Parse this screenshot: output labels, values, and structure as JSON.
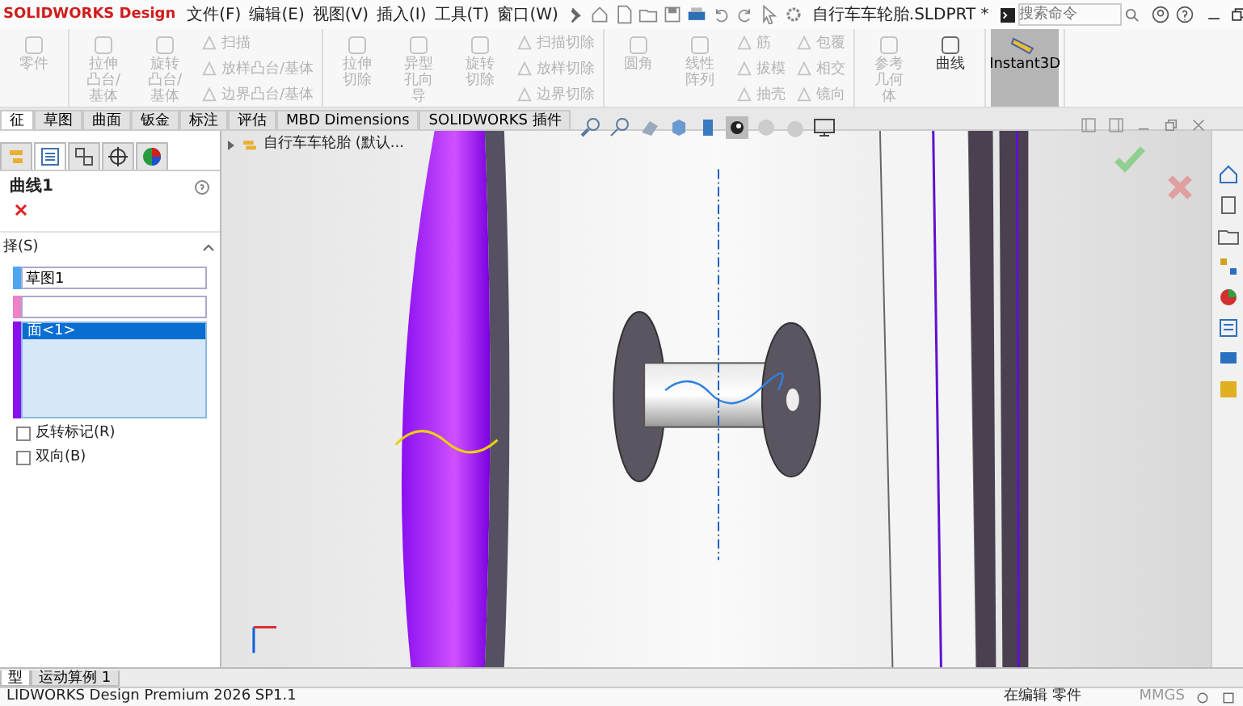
{
  "window": {
    "logo": "SOLIDWORKS Design",
    "document_title": "自行车车轮胎.SLDPRT *",
    "search": {
      "placeholder": "搜索命令"
    }
  },
  "menu": [
    "文件(F)",
    "编辑(E)",
    "视图(V)",
    "插入(I)",
    "工具(T)",
    "窗口(W)"
  ],
  "ribbon": [
    {
      "items": [
        {
          "kind": "large",
          "label": "零件",
          "disabled": true
        }
      ]
    },
    {
      "items": [
        {
          "kind": "large",
          "label": "拉伸凸台/基体",
          "disabled": true
        },
        {
          "kind": "large",
          "label": "旋转凸台/基体",
          "disabled": true
        },
        {
          "kind": "small",
          "label": "扫描",
          "disabled": true
        },
        {
          "kind": "small",
          "label": "放样凸台/基体",
          "disabled": true
        },
        {
          "kind": "small",
          "label": "边界凸台/基体",
          "disabled": true
        }
      ]
    },
    {
      "items": [
        {
          "kind": "large",
          "label": "拉伸切除",
          "disabled": true
        },
        {
          "kind": "large",
          "label": "异型孔向导",
          "disabled": true
        },
        {
          "kind": "large",
          "label": "旋转切除",
          "disabled": true
        },
        {
          "kind": "small",
          "label": "扫描切除",
          "disabled": true
        },
        {
          "kind": "small",
          "label": "放样切除",
          "disabled": true
        },
        {
          "kind": "small",
          "label": "边界切除",
          "disabled": true
        }
      ]
    },
    {
      "items": [
        {
          "kind": "large",
          "label": "圆角",
          "disabled": true
        },
        {
          "kind": "large",
          "label": "线性阵列",
          "disabled": true
        },
        {
          "kind": "small",
          "label": "筋",
          "disabled": true
        },
        {
          "kind": "small",
          "label": "拔模",
          "disabled": true
        },
        {
          "kind": "small",
          "label": "抽壳",
          "disabled": true
        },
        {
          "kind": "small",
          "label": "包覆",
          "disabled": true
        },
        {
          "kind": "small",
          "label": "相交",
          "disabled": true
        },
        {
          "kind": "small",
          "label": "镜向",
          "disabled": true
        }
      ]
    },
    {
      "items": [
        {
          "kind": "large",
          "label": "参考几何体",
          "disabled": true
        },
        {
          "kind": "large",
          "label": "曲线",
          "disabled": false
        }
      ]
    },
    {
      "items": [
        {
          "kind": "toggle",
          "label": "Instant3D",
          "selected": true
        }
      ]
    }
  ],
  "command_tabs": [
    {
      "label": "征",
      "selected": true
    },
    {
      "label": "草图",
      "selected": false
    },
    {
      "label": "曲面",
      "selected": false
    },
    {
      "label": "钣金",
      "selected": false
    },
    {
      "label": "标注",
      "selected": false
    },
    {
      "label": "评估",
      "selected": false
    },
    {
      "label": "MBD Dimensions",
      "selected": false
    },
    {
      "label": "SOLIDWORKS 插件",
      "selected": false
    }
  ],
  "property_manager": {
    "tabs": [
      {
        "kind": "feature",
        "selected": false
      },
      {
        "kind": "property",
        "selected": true
      },
      {
        "kind": "config",
        "selected": false
      },
      {
        "kind": "origin",
        "selected": false
      },
      {
        "kind": "appearance",
        "selected": false
      }
    ],
    "title": "曲线1",
    "section": "择(S)",
    "fields": [
      {
        "value": "草图1",
        "color": "#4da6f0"
      },
      {
        "color": "#f080c8"
      }
    ],
    "list": {
      "color": "#8a10f0",
      "items": [
        {
          "label": "面<1>",
          "selected": true
        }
      ]
    },
    "checkboxes": [
      {
        "label": "反转标记(R)",
        "checked": false
      },
      {
        "label": "双向(B)",
        "checked": false
      }
    ]
  },
  "viewport": {
    "tree_item": "自行车车轮胎 (默认..."
  },
  "bottom_tabs": [
    {
      "label": "型",
      "selected": true
    },
    {
      "label": "运动算例 1",
      "selected": false
    }
  ],
  "status_bar": {
    "product": "LIDWORKS Design Premium 2026 SP1.1",
    "mode": "在编辑 零件",
    "units": "MMGS"
  }
}
